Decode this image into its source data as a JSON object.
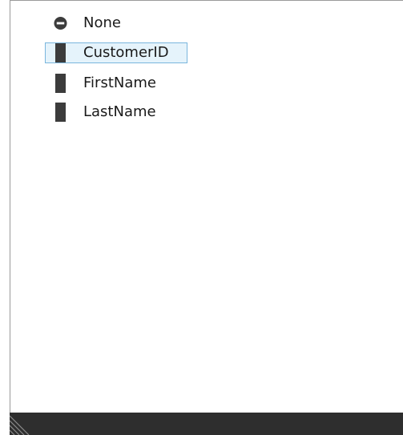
{
  "field_list": {
    "items": [
      {
        "label": "None",
        "icon": "none-circle-icon",
        "selected": false
      },
      {
        "label": "CustomerID",
        "icon": "field-column-icon",
        "selected": true
      },
      {
        "label": "FirstName",
        "icon": "field-column-icon",
        "selected": false
      },
      {
        "label": "LastName",
        "icon": "field-column-icon",
        "selected": false
      }
    ]
  },
  "colors": {
    "selection_background": "#e5f3fb",
    "selection_border": "#7ab6dd",
    "icon_fill": "#3c3c3c",
    "bottom_bar": "#2e2e2e"
  }
}
